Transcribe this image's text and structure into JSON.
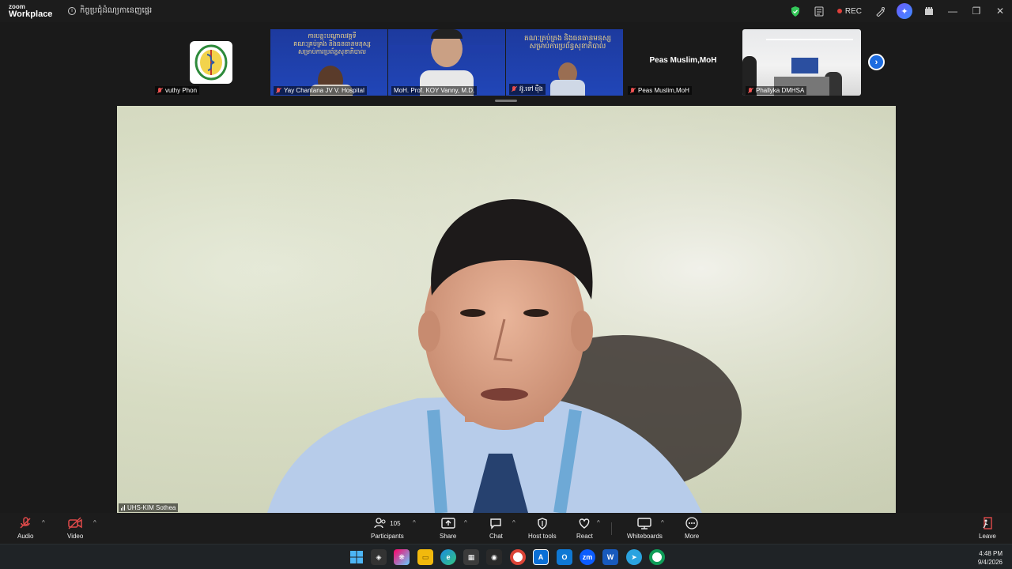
{
  "app": {
    "brand_line1": "zoom",
    "brand_line2": "Workplace",
    "meeting_title": "កិច្ចប្រជុំដំណ្យកានេញផ្ទេរ",
    "rec_label": "REC"
  },
  "gallery": [
    {
      "name": "vuthy Phon",
      "muted": true
    },
    {
      "name": "Yay Chantana JV V. Hospital",
      "muted": true
    },
    {
      "name": "MoH. Prof. KOY Vanny, M.D.",
      "muted": false
    },
    {
      "name": "អ៊ូ.ទៅ ម៉ឹង",
      "muted": true
    },
    {
      "name": "Peas Muslim,MoH",
      "muted": true,
      "display_text": "Peas Muslim,MoH"
    },
    {
      "name": "Phallyka DMHSA",
      "muted": true
    }
  ],
  "main_video": {
    "speaker_name": "UHS-KIM Sothea"
  },
  "controls": {
    "audio": "Audio",
    "video": "Video",
    "participants": "Participants",
    "participants_count": "105",
    "share": "Share",
    "chat": "Chat",
    "host_tools": "Host tools",
    "react": "React",
    "whiteboards": "Whiteboards",
    "more": "More",
    "leave": "Leave"
  },
  "taskbar": {
    "time": "4:48 PM",
    "date": "9/4/2026",
    "apps": [
      "windows-start",
      "dark-app",
      "copilot",
      "file-explorer",
      "edge",
      "store",
      "github",
      "chrome",
      "azure",
      "outlook",
      "zoom",
      "word",
      "telegram",
      "chrome-2"
    ]
  },
  "colors": {
    "accent_blue": "#1d6ce0",
    "muted_red": "#e04a4a",
    "security_green": "#34c759"
  }
}
